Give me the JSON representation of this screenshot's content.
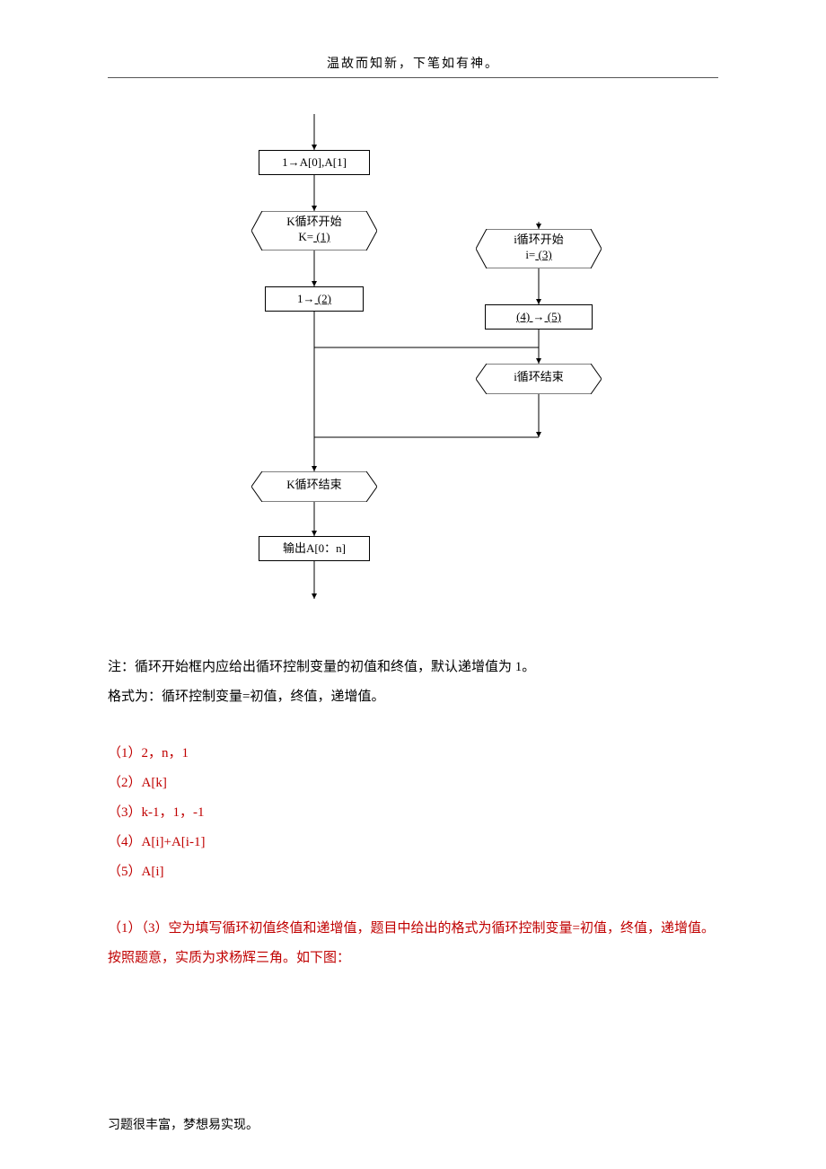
{
  "header": "温故而知新，下笔如有神。",
  "flow": {
    "box_init": "1→A[0],A[1]",
    "hex_k_start_l1": "K循环开始",
    "hex_k_start_l2_pre": "K=",
    "hex_k_start_l2_u": " (1) ",
    "box_assign_pre": "1→",
    "box_assign_u": " (2) ",
    "hex_i_start_l1": "i循环开始",
    "hex_i_start_l2_pre": "i=",
    "hex_i_start_l2_u": " (3) ",
    "box_i_body_u1": " (4) ",
    "box_i_body_mid": "→",
    "box_i_body_u2": " (5) ",
    "hex_i_end": "i循环结束",
    "hex_k_end": "K循环结束",
    "box_output": "输出A[0：n]"
  },
  "notes": {
    "l1": "注：循环开始框内应给出循环控制变量的初值和终值，默认递增值为 1。",
    "l2": "格式为：循环控制变量=初值，终值，递增值。"
  },
  "answers": {
    "a1": "（1）2，n，1",
    "a2": "（2）A[k]",
    "a3": "（3）k-1，1，-1",
    "a4": "（4）A[i]+A[i-1]",
    "a5": "（5）A[i]"
  },
  "explain": "（1）（3）空为填写循环初值终值和递增值，题目中给出的格式为循环控制变量=初值，终值，递增值。按照题意，实质为求杨辉三角。如下图：",
  "footer": "习题很丰富，梦想易实现。"
}
